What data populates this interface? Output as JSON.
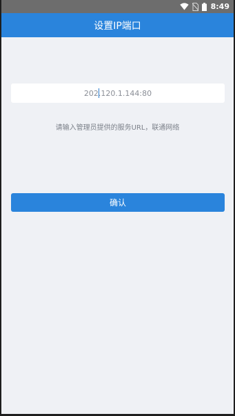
{
  "status_bar": {
    "time": "8:49",
    "icons": [
      "wifi-icon",
      "no-sim-icon",
      "battery-icon"
    ]
  },
  "app_bar": {
    "title": "设置IP端口"
  },
  "server_input": {
    "value": "202.120.1.144:80",
    "placeholder": ""
  },
  "hint": {
    "text": "请输入管理员提供的服务URL，联通网络"
  },
  "confirm_button": {
    "label": "确认"
  },
  "colors": {
    "primary": "#2a84dc",
    "background": "#eff1f5",
    "status_bar": "#6d6d6d",
    "hint_text": "#7b8089"
  }
}
